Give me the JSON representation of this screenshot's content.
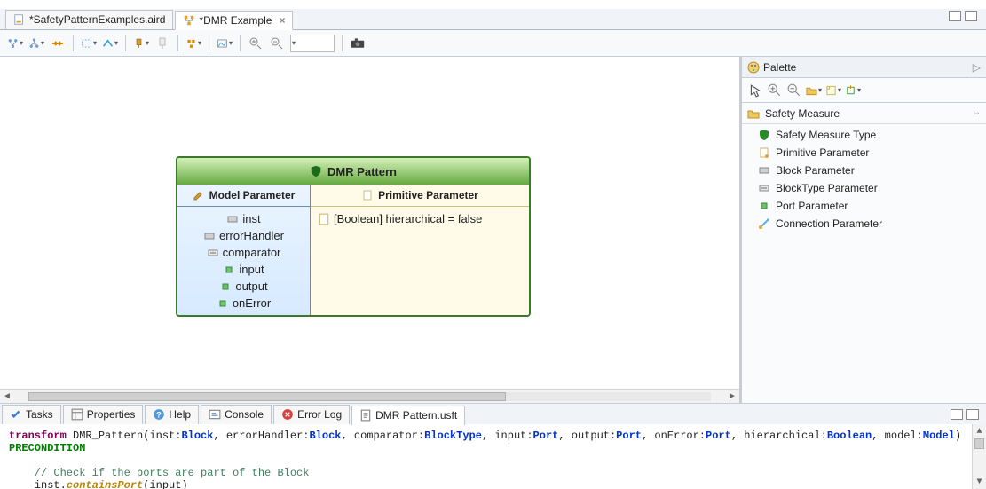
{
  "editor_tabs": [
    {
      "label": "*SafetyPatternExamples.aird",
      "active": false
    },
    {
      "label": "*DMR Example",
      "active": true
    }
  ],
  "diagram": {
    "title": "DMR Pattern",
    "left_header": "Model Parameter",
    "right_header": "Primitive Parameter",
    "model_params": [
      "inst",
      "errorHandler",
      "comparator",
      "input",
      "output",
      "onError"
    ],
    "primitive_params": [
      "[Boolean] hierarchical = false"
    ]
  },
  "palette": {
    "title": "Palette",
    "section": "Safety Measure",
    "items": [
      "Safety Measure Type",
      "Primitive Parameter",
      "Block Parameter",
      "BlockType Parameter",
      "Port Parameter",
      "Connection Parameter"
    ]
  },
  "views": [
    "Tasks",
    "Properties",
    "Help",
    "Console",
    "Error Log",
    "DMR Pattern.usft"
  ],
  "active_view_index": 5,
  "code": {
    "l1_kw": "transform",
    "l1_name": " DMR_Pattern(inst:",
    "l1_t1": "Block",
    "l1_a": ", errorHandler:",
    "l1_t2": "Block",
    "l1_b": ", comparator:",
    "l1_t3": "BlockType",
    "l1_c": ", input:",
    "l1_t4": "Port",
    "l1_d": ", output:",
    "l1_t5": "Port",
    "l1_e": ", onError:",
    "l1_t6": "Port",
    "l1_f": ", hierarchical:",
    "l1_t7": "Boolean",
    "l1_g": ", model:",
    "l1_t8": "Model",
    "l1_h": ")",
    "l2": "PRECONDITION",
    "l4": "    // Check if the ports are part of the Block",
    "l5a": "    inst.",
    "l5b": "containsPort",
    "l5c": "(input)"
  }
}
